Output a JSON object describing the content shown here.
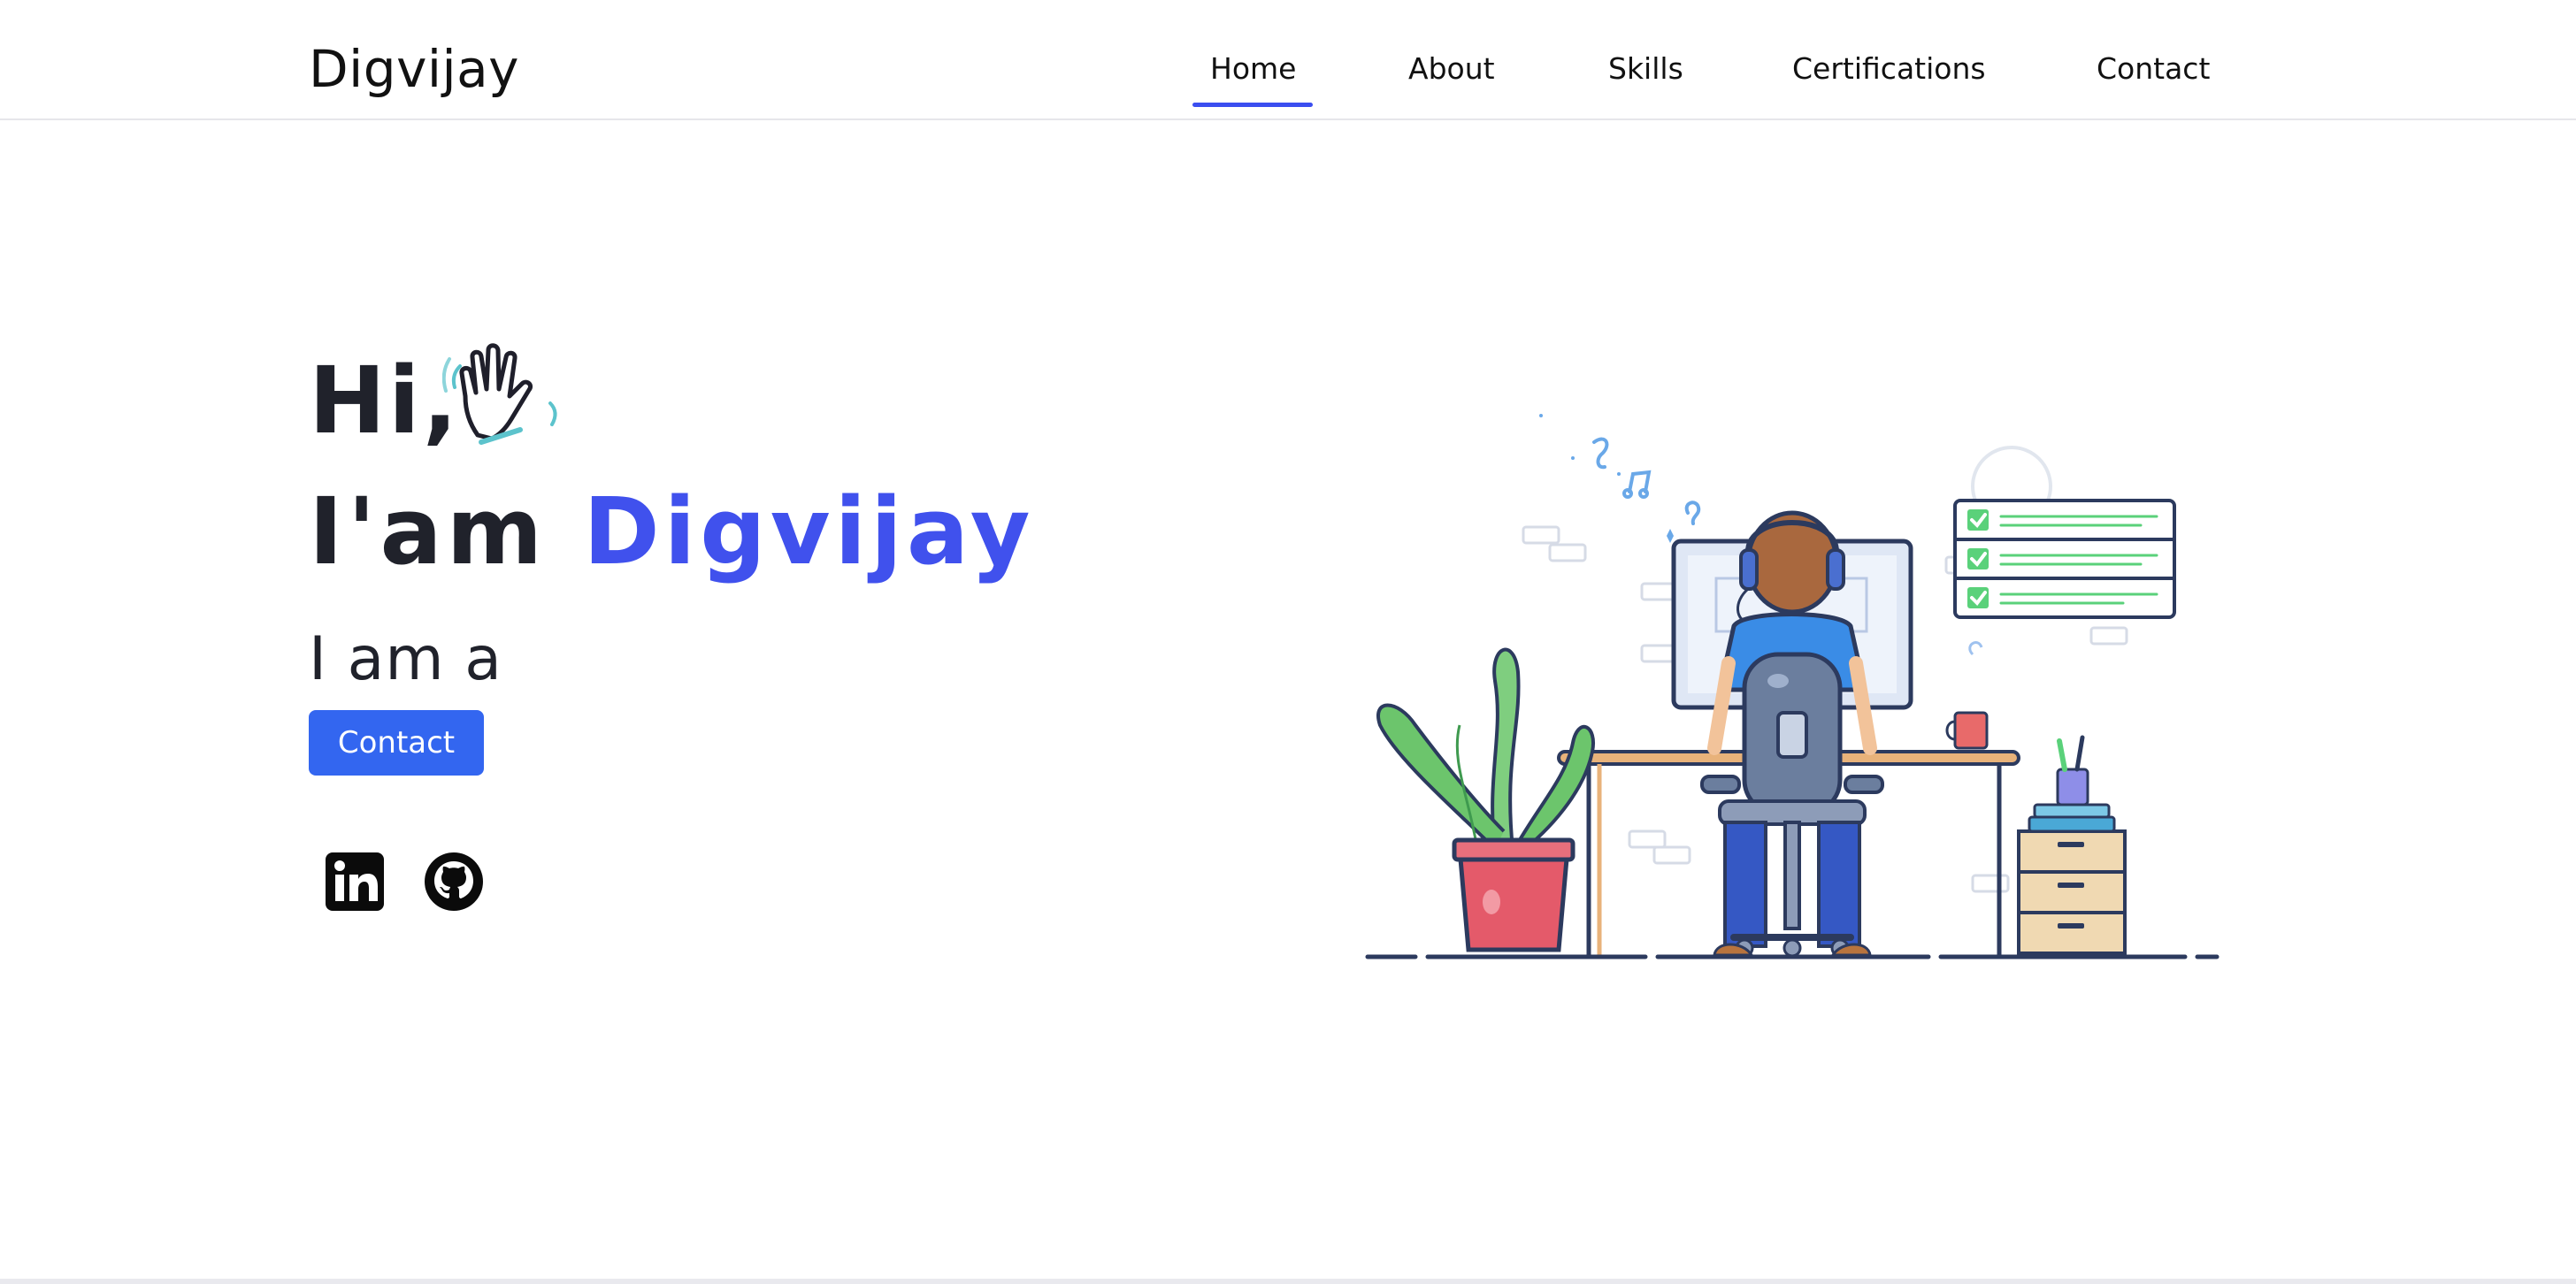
{
  "header": {
    "logo": "Digvijay",
    "nav": [
      {
        "label": "Home",
        "active": true
      },
      {
        "label": "About",
        "active": false
      },
      {
        "label": "Skills",
        "active": false
      },
      {
        "label": "Certifications",
        "active": false
      },
      {
        "label": "Contact",
        "active": false
      }
    ]
  },
  "hero": {
    "greeting": "Hi,",
    "intro_prefix": "I'am",
    "intro_name": "Digvijay",
    "role_prefix": "I am a",
    "contact_button": "Contact",
    "socials": [
      {
        "icon": "linkedin-icon"
      },
      {
        "icon": "github-icon"
      }
    ]
  },
  "colors": {
    "accent": "#4051ed",
    "button": "#3366f0",
    "text": "#20222b"
  }
}
